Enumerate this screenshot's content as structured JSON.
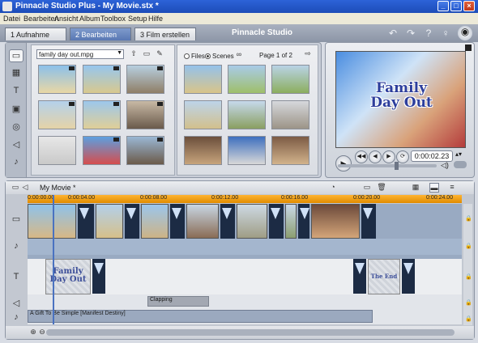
{
  "window": {
    "title": "Pinnacle Studio Plus - My Movie.stx *",
    "controls": [
      "_",
      "□",
      "×"
    ]
  },
  "menu": [
    "Datei",
    "Bearbeiten",
    "Ansicht",
    "Album",
    "Toolbox",
    "Setup",
    "Hilfe"
  ],
  "tabs": [
    {
      "label": "1 Aufnahme",
      "active": false
    },
    {
      "label": "2 Bearbeiten",
      "active": true
    },
    {
      "label": "3 Film erstellen",
      "active": false
    }
  ],
  "brand": "Pinnacle Studio",
  "toolbar_icons": [
    "undo-icon",
    "redo-icon",
    "help-icon",
    "tip-icon",
    "camera-icon"
  ],
  "album": {
    "sidebar_icons": [
      "video-icon",
      "transition-icon",
      "title-icon",
      "image-icon",
      "disc-menu-icon",
      "sound-icon",
      "music-icon"
    ],
    "folder": "family day out.mpg",
    "file_mode": "Files",
    "scene_mode": "Scenes",
    "page": "Page 1 of 2"
  },
  "player": {
    "title_line1": "Family",
    "title_line2": "Day Out",
    "timecode": "0:00:02.23",
    "buttons": [
      "play",
      "rewind",
      "back",
      "forward",
      "fast-forward",
      "loop"
    ]
  },
  "timeline": {
    "project": "My Movie *",
    "ruler": [
      "0:00:00.00",
      "0:00:04.00",
      "0:00:08.00",
      "0:00:12.00",
      "0:00:16.00",
      "0:00:20.00",
      "0:00:24.00"
    ],
    "title_clip_1": "Family Day Out",
    "title_clip_2": "The End",
    "sfx_clip": "Clapping",
    "music_clip": "A Gift To Be Simple [Manifest Destiny]"
  },
  "colors": {
    "ruler": "#f2a000",
    "titlebar": "#2d63d8",
    "active_tab": "#6a88c2"
  }
}
